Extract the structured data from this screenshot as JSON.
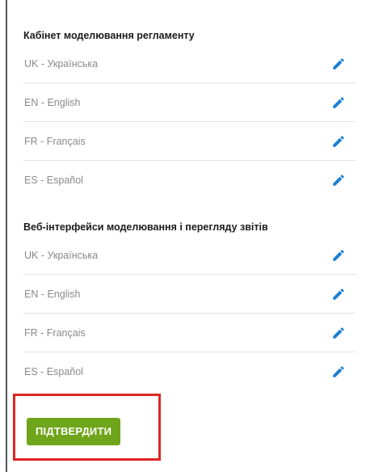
{
  "sections": [
    {
      "title": "Кабінет моделювання регламенту",
      "languages": [
        {
          "label": "UK - Українська",
          "icon": "pencil-icon"
        },
        {
          "label": "EN - English",
          "icon": "pencil-icon"
        },
        {
          "label": "FR - Français",
          "icon": "pencil-icon"
        },
        {
          "label": "ES - Español",
          "icon": "pencil-icon"
        }
      ]
    },
    {
      "title": "Веб-інтерфейси моделювання і перегляду звітів",
      "languages": [
        {
          "label": "UK - Українська",
          "icon": "pencil-icon"
        },
        {
          "label": "EN - English",
          "icon": "pencil-icon"
        },
        {
          "label": "FR - Français",
          "icon": "pencil-icon"
        },
        {
          "label": "ES - Español",
          "icon": "pencil-icon"
        }
      ]
    }
  ],
  "confirm": {
    "label": "ПІДТВЕРДИТИ"
  },
  "colors": {
    "edit_icon": "#1a7fd4",
    "confirm_button": "#6fa51a",
    "highlight_frame": "#e02424"
  }
}
